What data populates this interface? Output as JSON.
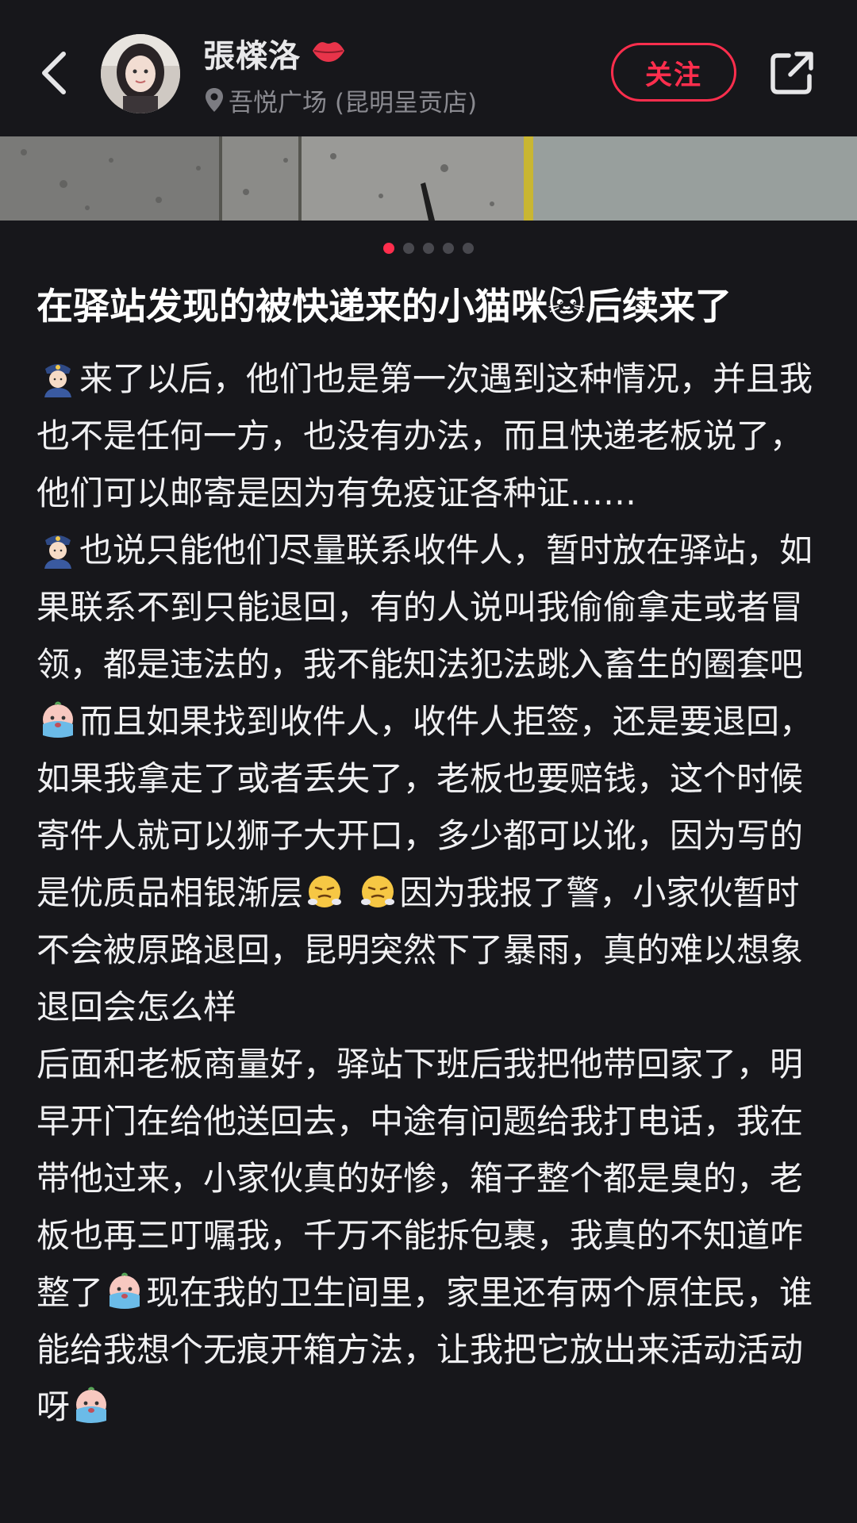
{
  "header": {
    "author_name": "張檪洛",
    "location": "吾悦广场 (昆明呈贡店)",
    "follow_label": "关注"
  },
  "gallery": {
    "image_count": 5,
    "active_index": 0
  },
  "post": {
    "title": "在驿站发现的被快递来的小猫咪🐱后续来了",
    "p1": "来了以后，他们也是第一次遇到这种情况，并且我也不是任何一方，也没有办法，而且快递老板说了，他们可以邮寄是因为有免疫证各种证……",
    "p2a": "也说只能他们尽量联系收件人，暂时放在驿站，如果联系不到只能退回，有的人说叫我偷偷拿走或者冒领，都是违法的，我不能知法犯法跳入畜生的圈套吧",
    "p2b": "而且如果找到收件人，收件人拒签，还是要退回，如果我拿走了或者丢失了，老板也要赔钱，这个时候寄件人就可以狮子大开口，多少都可以讹，因为写的是优质品相银渐层",
    "p2c": "因为我报了警，小家伙暂时不会被原路退回，昆明突然下了暴雨，真的难以想象退回会怎么样",
    "p3a": "后面和老板商量好，驿站下班后我把他带回家了，明早开门在给他送回去，中途有问题给我打电话，我在带他过来，小家伙真的好惨，箱子整个都是臭的，老板也再三叮嘱我，千万不能拆包裹，我真的不知道咋整了",
    "p3b": "现在我的卫生间里，家里还有两个原住民，谁能给我想个无痕开箱方法，让我把它放出来活动活动呀"
  },
  "colors": {
    "accent": "#ff2e4d",
    "background": "#17171b",
    "secondary_text": "#8a8a90"
  }
}
